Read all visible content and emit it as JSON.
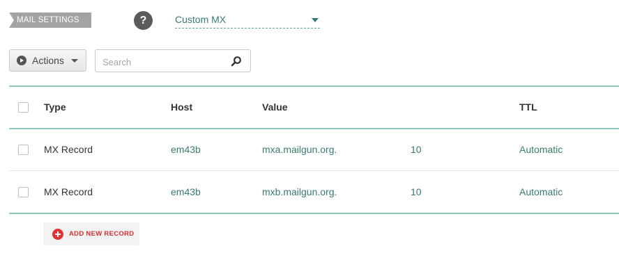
{
  "settings": {
    "section_tag": "MAIL SETTINGS",
    "help_label": "?",
    "mail_mode": "Custom MX"
  },
  "toolbar": {
    "actions_label": "Actions",
    "search_placeholder": "Search"
  },
  "table": {
    "headers": [
      "Type",
      "Host",
      "Value",
      "",
      "TTL"
    ],
    "rows": [
      {
        "type": "MX Record",
        "host": "em43b",
        "value": "mxa.mailgun.org.",
        "priority": "10",
        "ttl": "Automatic"
      },
      {
        "type": "MX Record",
        "host": "em43b",
        "value": "mxb.mailgun.org.",
        "priority": "10",
        "ttl": "Automatic"
      }
    ]
  },
  "add_record_label": "ADD NEW RECORD",
  "colors": {
    "accent_teal": "#3a7a70",
    "rule_teal": "#8fc7bd",
    "add_red": "#e03434",
    "tag_gray": "#a3a3a3"
  }
}
